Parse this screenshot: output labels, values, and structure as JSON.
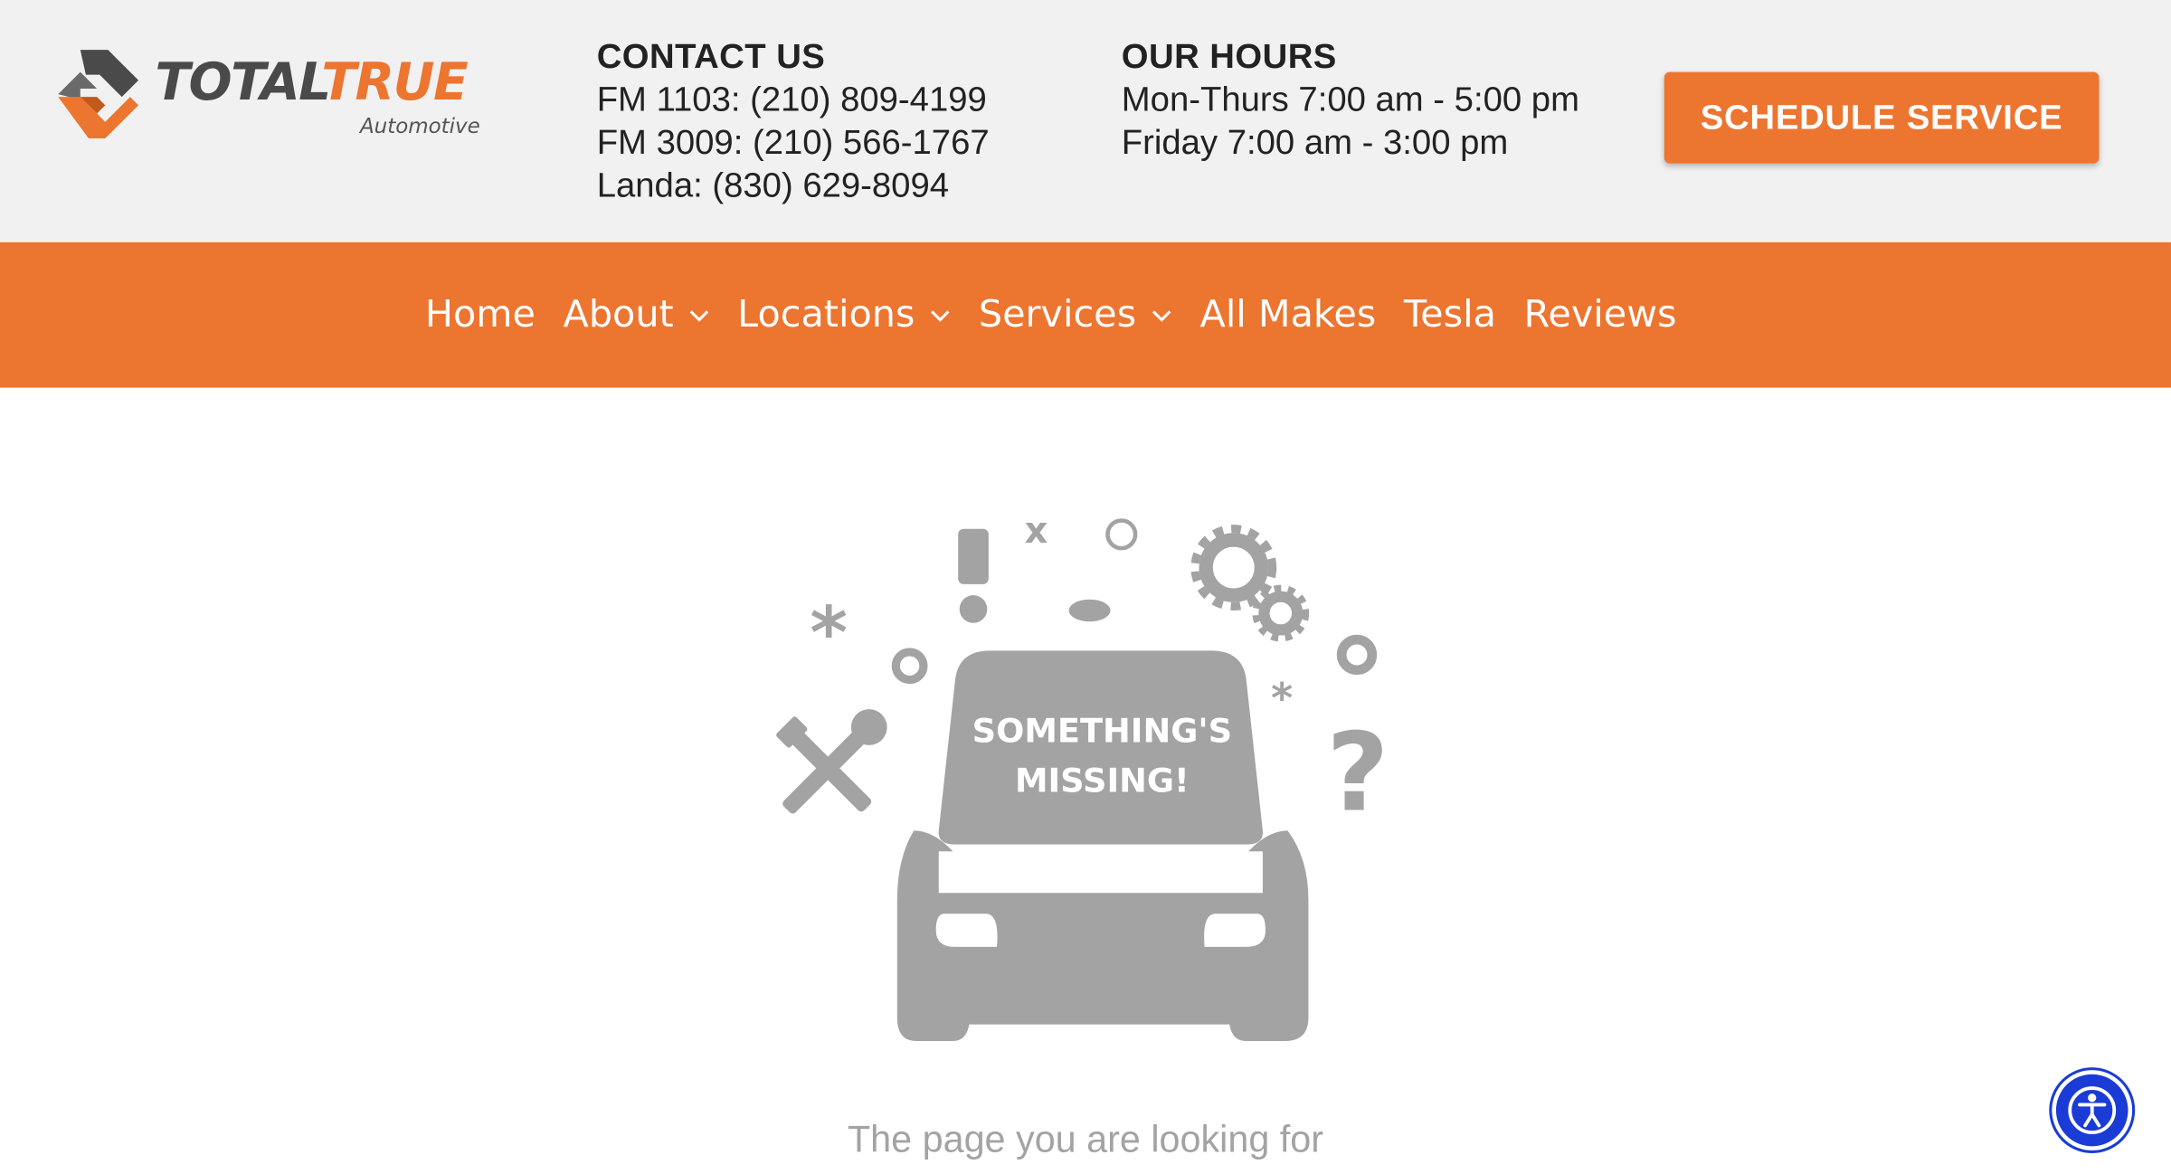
{
  "brand": {
    "name_part1": "TOTAL",
    "name_part2": "TRUE",
    "subtitle": "Automotive",
    "accent_color": "#ec7530",
    "dark_color": "#4a4a4a"
  },
  "contact": {
    "title": "CONTACT US",
    "lines": [
      "FM 1103: (210) 809-4199",
      "FM 3009: (210) 566-1767",
      "Landa: (830) 629-8094"
    ]
  },
  "hours": {
    "title": "OUR HOURS",
    "lines": [
      "Mon-Thurs 7:00 am - 5:00 pm",
      "Friday 7:00 am - 3:00 pm"
    ]
  },
  "cta": {
    "label": "SCHEDULE SERVICE"
  },
  "nav": {
    "items": [
      {
        "label": "Home",
        "has_dropdown": false
      },
      {
        "label": "About",
        "has_dropdown": true
      },
      {
        "label": "Locations",
        "has_dropdown": true
      },
      {
        "label": "Services",
        "has_dropdown": true
      },
      {
        "label": "All Makes",
        "has_dropdown": false
      },
      {
        "label": "Tesla",
        "has_dropdown": false
      },
      {
        "label": "Reviews",
        "has_dropdown": false
      }
    ],
    "dropdown_icon": "chevron-down-icon"
  },
  "error": {
    "line1": "SOMETHING'S",
    "line2": "MISSING!",
    "tagline": "The page you are looking for",
    "illustration_icon": "car-hood-open-icon"
  },
  "accessibility": {
    "icon": "accessibility-icon",
    "color": "#1a3bd6"
  }
}
